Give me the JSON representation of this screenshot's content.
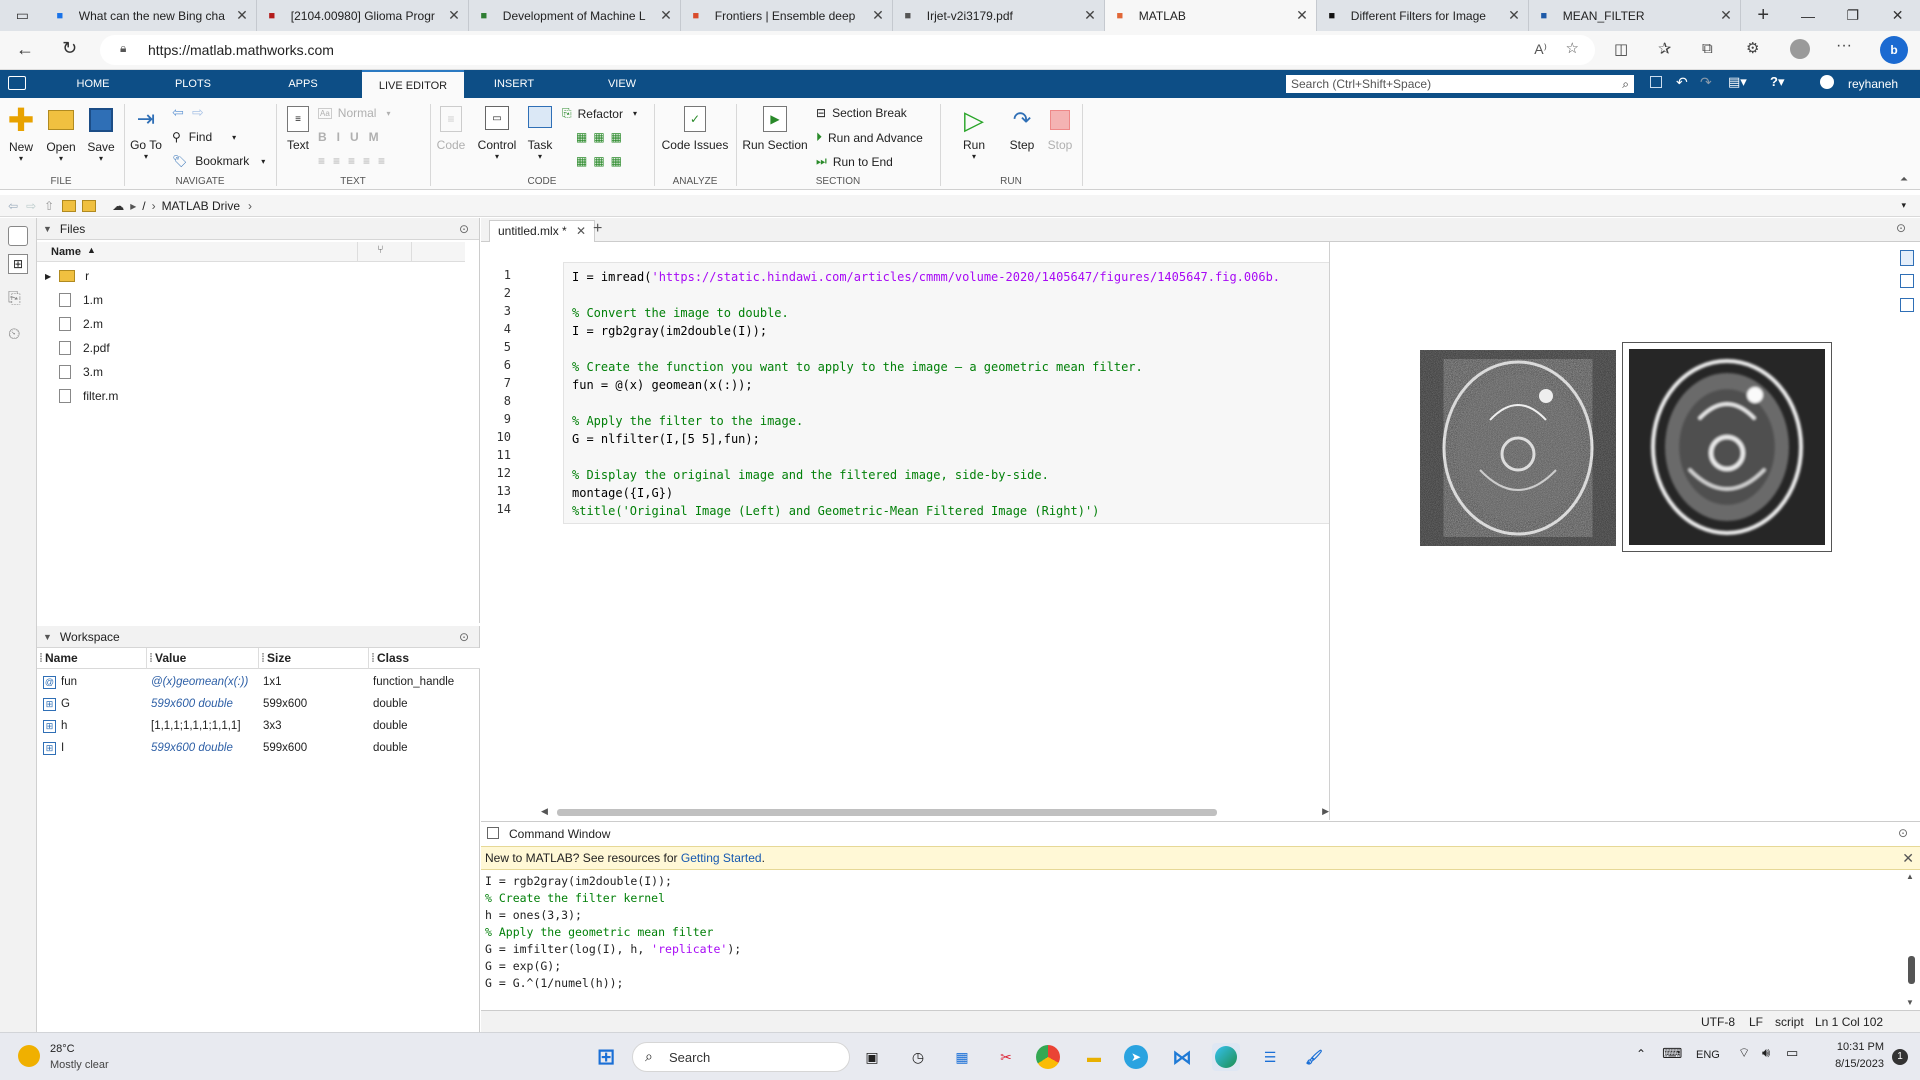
{
  "browser": {
    "tabs": [
      {
        "title": "What can the new Bing cha",
        "icon": "search-icon",
        "color": "#1a73e8"
      },
      {
        "title": "[2104.00980] Glioma Progr",
        "icon": "arxiv-icon",
        "color": "#b31b1b"
      },
      {
        "title": "Development of Machine L",
        "icon": "globe-icon",
        "color": "#2e7d32"
      },
      {
        "title": "Frontiers | Ensemble deep",
        "icon": "frontiers-icon",
        "color": "#d94b2b"
      },
      {
        "title": "Irjet-v2i3179.pdf",
        "icon": "pdf-icon",
        "color": "#555555"
      },
      {
        "title": "MATLAB",
        "icon": "matlab-icon",
        "color": "#e16737",
        "active": true
      },
      {
        "title": "Different Filters for Image",
        "icon": "video-icon",
        "color": "#111111"
      },
      {
        "title": "MEAN_FILTER",
        "icon": "nvs-icon",
        "color": "#1e5aa8"
      }
    ],
    "url": "https://matlab.mathworks.com"
  },
  "matlab": {
    "tabs": [
      "HOME",
      "PLOTS",
      "APPS",
      "LIVE EDITOR",
      "INSERT",
      "VIEW"
    ],
    "active_tab": "LIVE EDITOR",
    "search_placeholder": "Search (Ctrl+Shift+Space)",
    "user": "reyhaneh",
    "ribbon": {
      "file": {
        "group": "FILE",
        "new": "New",
        "open": "Open",
        "save": "Save"
      },
      "navigate": {
        "group": "NAVIGATE",
        "goto": "Go To",
        "find": "Find",
        "bookmark": "Bookmark"
      },
      "text": {
        "group": "TEXT",
        "text": "Text",
        "style": "Normal"
      },
      "code": {
        "group": "CODE",
        "code": "Code",
        "control": "Control",
        "task": "Task",
        "refactor": "Refactor"
      },
      "analyze": {
        "group": "ANALYZE",
        "code_issues": "Code Issues"
      },
      "section": {
        "group": "SECTION",
        "run_section": "Run Section",
        "section_break": "Section Break",
        "run_advance": "Run and Advance",
        "run_end": "Run to End"
      },
      "run": {
        "group": "RUN",
        "run": "Run",
        "step": "Step",
        "stop": "Stop"
      }
    },
    "path": [
      "/",
      "MATLAB Drive"
    ],
    "files": {
      "title": "Files",
      "col_name": "Name",
      "items": [
        {
          "name": "r",
          "type": "folder"
        },
        {
          "name": "1.m",
          "type": "m"
        },
        {
          "name": "2.m",
          "type": "m"
        },
        {
          "name": "2.pdf",
          "type": "pdf"
        },
        {
          "name": "3.m",
          "type": "m"
        },
        {
          "name": "filter.m",
          "type": "m"
        }
      ]
    },
    "workspace": {
      "title": "Workspace",
      "cols": [
        "Name",
        "Value",
        "Size",
        "Class"
      ],
      "rows": [
        {
          "name": "fun",
          "value": "@(x)geomean(x(:))",
          "size": "1x1",
          "class": "function_handle",
          "italic": true
        },
        {
          "name": "G",
          "value": "599x600 double",
          "size": "599x600",
          "class": "double",
          "italic": true
        },
        {
          "name": "h",
          "value": "[1,1,1;1,1,1;1,1,1]",
          "size": "3x3",
          "class": "double",
          "italic": false
        },
        {
          "name": "I",
          "value": "599x600 double",
          "size": "599x600",
          "class": "double",
          "italic": true
        }
      ]
    },
    "editor": {
      "tab": "untitled.mlx *",
      "lines": [
        {
          "n": "1",
          "parts": [
            {
              "t": "I = imread(",
              "c": ""
            },
            {
              "t": "'https://static.hindawi.com/articles/cmmm/volume-2020/1405647/figures/1405647.fig.006b.",
              "c": "st"
            }
          ]
        },
        {
          "n": "2",
          "parts": []
        },
        {
          "n": "3",
          "parts": [
            {
              "t": "% Convert the image to double.",
              "c": "cm"
            }
          ]
        },
        {
          "n": "4",
          "parts": [
            {
              "t": "I = rgb2gray(im2double(I));",
              "c": ""
            }
          ]
        },
        {
          "n": "5",
          "parts": []
        },
        {
          "n": "6",
          "parts": [
            {
              "t": "% Create the function you want to apply to the image — a geometric mean filter.",
              "c": "cm"
            }
          ]
        },
        {
          "n": "7",
          "parts": [
            {
              "t": "fun = @(x) geomean(x(:));",
              "c": ""
            }
          ]
        },
        {
          "n": "8",
          "parts": []
        },
        {
          "n": "9",
          "parts": [
            {
              "t": "% Apply the filter to the image.",
              "c": "cm"
            }
          ]
        },
        {
          "n": "10",
          "parts": [
            {
              "t": "G = nlfilter(I,[5 5],fun);",
              "c": ""
            }
          ]
        },
        {
          "n": "11",
          "parts": []
        },
        {
          "n": "12",
          "parts": [
            {
              "t": "% Display the original image and the filtered image, side-by-side.",
              "c": "cm"
            }
          ]
        },
        {
          "n": "13",
          "parts": [
            {
              "t": "montage({I,G})",
              "c": ""
            }
          ]
        },
        {
          "n": "14",
          "parts": [
            {
              "t": "%title('Original Image (Left) and Geometric-Mean Filtered Image (Right)')",
              "c": "cm"
            }
          ]
        }
      ]
    },
    "command_window": {
      "title": "Command Window",
      "banner": "New to MATLAB? See resources for",
      "banner_link": "Getting Started",
      "lines": [
        {
          "parts": [
            {
              "t": "I = rgb2gray(im2double(I));",
              "c": ""
            }
          ]
        },
        {
          "parts": [
            {
              "t": "% Create the filter kernel",
              "c": "cm"
            }
          ]
        },
        {
          "parts": [
            {
              "t": "h = ones(3,3);",
              "c": ""
            }
          ]
        },
        {
          "parts": [
            {
              "t": "% Apply the geometric mean filter",
              "c": "cm"
            }
          ]
        },
        {
          "parts": [
            {
              "t": "G = imfilter(log(I), h, ",
              "c": ""
            },
            {
              "t": "'replicate'",
              "c": "st"
            },
            {
              "t": ");",
              "c": ""
            }
          ]
        },
        {
          "parts": [
            {
              "t": "G = exp(G);",
              "c": ""
            }
          ]
        },
        {
          "parts": [
            {
              "t": "G = G.^(1/numel(h));",
              "c": ""
            }
          ]
        }
      ]
    },
    "status": {
      "encoding": "UTF-8",
      "eol": "LF",
      "mode": "script",
      "position": "Ln 1 Col 102"
    }
  },
  "taskbar": {
    "weather_temp": "28°C",
    "weather_desc": "Mostly clear",
    "search": "Search",
    "lang": "ENG",
    "time": "10:31 PM",
    "date": "8/15/2023",
    "notifications": "1"
  },
  "colors": {
    "matlab_blue": "#0d4e86",
    "comment": "#028009",
    "string": "#a709f5",
    "banner": "#fff8d6"
  }
}
